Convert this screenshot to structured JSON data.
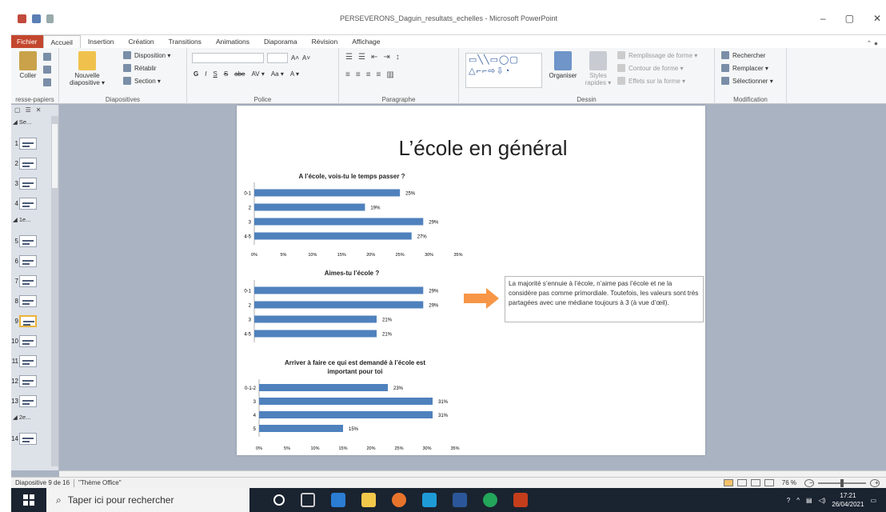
{
  "window": {
    "title": "PERSEVERONS_Daguin_resultats_echelles - Microsoft PowerPoint"
  },
  "tabs": [
    "Fichier",
    "Accueil",
    "Insertion",
    "Création",
    "Transitions",
    "Animations",
    "Diaporama",
    "Révision",
    "Affichage"
  ],
  "ribbon": {
    "clipboard": {
      "paste": "Coller",
      "label": "resse-papiers"
    },
    "slides": {
      "new_slide_1": "Nouvelle",
      "new_slide_2": "diapositive ▾",
      "layout": "Disposition ▾",
      "reset": "Rétablir",
      "section": "Section ▾",
      "label": "Diapositives"
    },
    "font": {
      "bold": "G",
      "italic": "I",
      "underline": "S",
      "strike": "S",
      "label": "Police",
      "abc": "abe",
      "av": "AV ▾",
      "aa": "Aa ▾",
      "acolor": "A ▾"
    },
    "paragraph": {
      "label": "Paragraphe"
    },
    "drawing": {
      "organize": "Organiser",
      "styles_1": "Styles",
      "styles_2": "rapides ▾",
      "fill": "Remplissage de forme ▾",
      "outline": "Contour de forme ▾",
      "effects": "Effets sur la forme ▾",
      "label": "Dessin"
    },
    "editing": {
      "find": "Rechercher",
      "replace": "Remplacer ▾",
      "select": "Sélectionner ▾",
      "label": "Modification"
    }
  },
  "left_panel": {
    "sections": [
      "Se...",
      "1e...",
      "2e..."
    ],
    "slides": [
      "1",
      "2",
      "3",
      "4",
      "5",
      "6",
      "7",
      "8",
      "9",
      "10",
      "11",
      "12",
      "13",
      "14"
    ],
    "selected": "9"
  },
  "slide": {
    "title": "L’école en général",
    "note": "La majorité s’ennuie à l’école, n’aime pas l’école et ne la considère pas comme primordiale. Toutefois, les valeurs sont très partagées avec une médiane toujours à 3 (à vue d’œil).",
    "bar_color": "#4f81bd",
    "arrow_color": "#f79646"
  },
  "chart_data": [
    {
      "type": "bar",
      "orientation": "horizontal",
      "title": "A l’école, vois-tu le temps passer ?",
      "categories": [
        "0-1",
        "2",
        "3",
        "4-5"
      ],
      "values": [
        25,
        19,
        29,
        27
      ],
      "value_labels": [
        "25%",
        "19%",
        "29%",
        "27%"
      ],
      "xticks": [
        "0%",
        "5%",
        "10%",
        "15%",
        "20%",
        "25%",
        "30%",
        "35%"
      ],
      "xlim": [
        0,
        35
      ]
    },
    {
      "type": "bar",
      "orientation": "horizontal",
      "title": "Aimes-tu l’école ?",
      "categories": [
        "0-1",
        "2",
        "3",
        "4-5"
      ],
      "values": [
        29,
        29,
        21,
        21
      ],
      "value_labels": [
        "29%",
        "29%",
        "21%",
        "21%"
      ],
      "xticks": [],
      "xlim": [
        0,
        35
      ]
    },
    {
      "type": "bar",
      "orientation": "horizontal",
      "title": "Arriver à faire ce qui est demandé à l’école est important pour toi",
      "categories": [
        "0-1-2",
        "3",
        "4",
        "5"
      ],
      "values": [
        23,
        31,
        31,
        15
      ],
      "value_labels": [
        "23%",
        "31%",
        "31%",
        "15%"
      ],
      "xticks": [
        "0%",
        "5%",
        "10%",
        "15%",
        "20%",
        "25%",
        "30%",
        "35%"
      ],
      "xlim": [
        0,
        35
      ]
    }
  ],
  "status": {
    "slide_info": "Diapositive 9 de 16",
    "theme": "\"Thème Office\"",
    "zoom": "76 %"
  },
  "taskbar": {
    "search_placeholder": "Taper ici pour rechercher",
    "time": "17:21",
    "date": "26/04/2021"
  }
}
